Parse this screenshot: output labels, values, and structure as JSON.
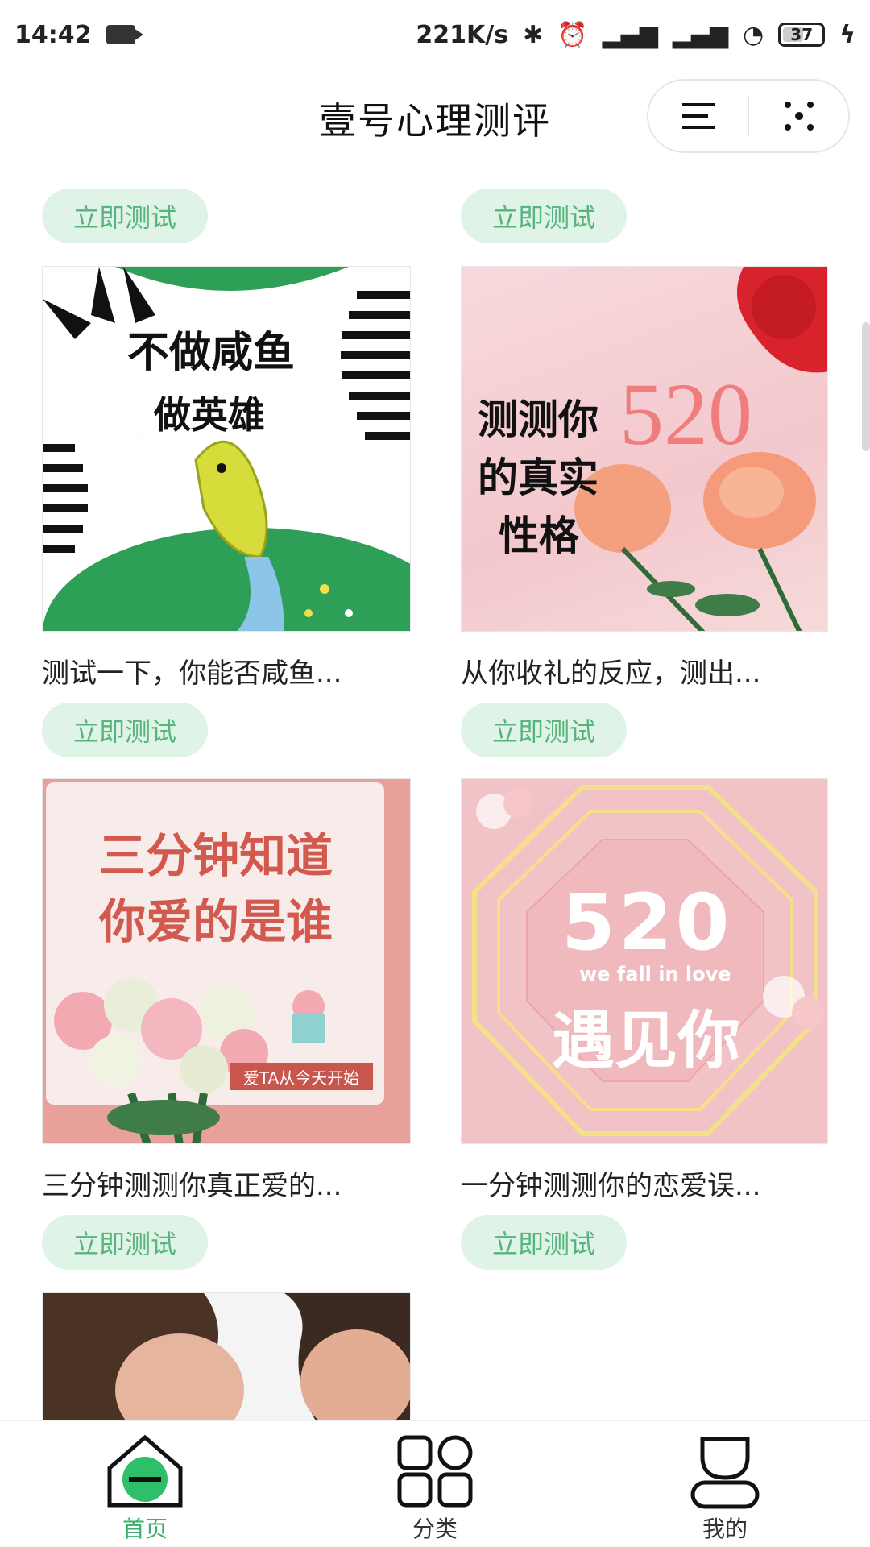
{
  "status_bar": {
    "time": "14:42",
    "network_speed": "221K/s",
    "battery": "37"
  },
  "header": {
    "title": "壹号心理测评",
    "menu_icon": "menu-icon",
    "close_icon": "close-icon"
  },
  "button_label": "立即测试",
  "cards": [
    {
      "title": "测试一下，你能否咸鱼...",
      "image": {
        "line1": "不做咸鱼",
        "line2": "做英雄"
      }
    },
    {
      "title": "从你收礼的反应，测出...",
      "image": {
        "line1": "测测你",
        "line2": "的真实",
        "line3": "性格",
        "number": "520"
      }
    },
    {
      "title": "三分钟测测你真正爱的...",
      "image": {
        "line1": "三分钟知道",
        "line2": "你爱的是谁",
        "tag": "爱TA从今天开始"
      }
    },
    {
      "title": "一分钟测测你的恋爱误...",
      "image": {
        "number": "520",
        "sub": "we fall in love",
        "line1": "遇见你"
      }
    }
  ],
  "tabbar": {
    "items": [
      {
        "label": "首页",
        "icon": "home-icon",
        "active": true
      },
      {
        "label": "分类",
        "icon": "category-icon",
        "active": false
      },
      {
        "label": "我的",
        "icon": "profile-icon",
        "active": false
      }
    ]
  },
  "colors": {
    "accent": "#3bb06c",
    "button_bg": "#dff3e7",
    "button_text": "#58b47e"
  }
}
